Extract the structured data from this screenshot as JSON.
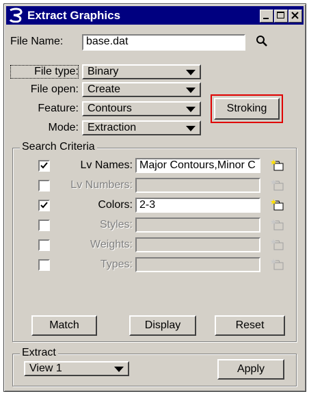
{
  "window": {
    "title": "Extract Graphics"
  },
  "file_name": {
    "label": "File Name:",
    "value": "base.dat"
  },
  "file_type": {
    "label": "File type:",
    "value": "Binary"
  },
  "file_open": {
    "label": "File open:",
    "value": "Create"
  },
  "feature": {
    "label": "Feature:",
    "value": "Contours"
  },
  "mode": {
    "label": "Mode:",
    "value": "Extraction"
  },
  "stroking_button": "Stroking",
  "search_criteria": {
    "title": "Search Criteria",
    "rows": [
      {
        "label": "Lv Names:",
        "value": "Major Contours,Minor C",
        "checked": true,
        "enabled": true
      },
      {
        "label": "Lv Numbers:",
        "value": "",
        "checked": false,
        "enabled": false
      },
      {
        "label": "Colors:",
        "value": "2-3",
        "checked": true,
        "enabled": true
      },
      {
        "label": "Styles:",
        "value": "",
        "checked": false,
        "enabled": false
      },
      {
        "label": "Weights:",
        "value": "",
        "checked": false,
        "enabled": false
      },
      {
        "label": "Types:",
        "value": "",
        "checked": false,
        "enabled": false
      }
    ],
    "buttons": {
      "match": "Match",
      "display": "Display",
      "reset": "Reset"
    }
  },
  "extract": {
    "title": "Extract",
    "view": "View 1",
    "apply": "Apply"
  },
  "colors": {
    "titlebar": "#000080",
    "face": "#d4d0c8",
    "highlight_border": "#e00000"
  }
}
